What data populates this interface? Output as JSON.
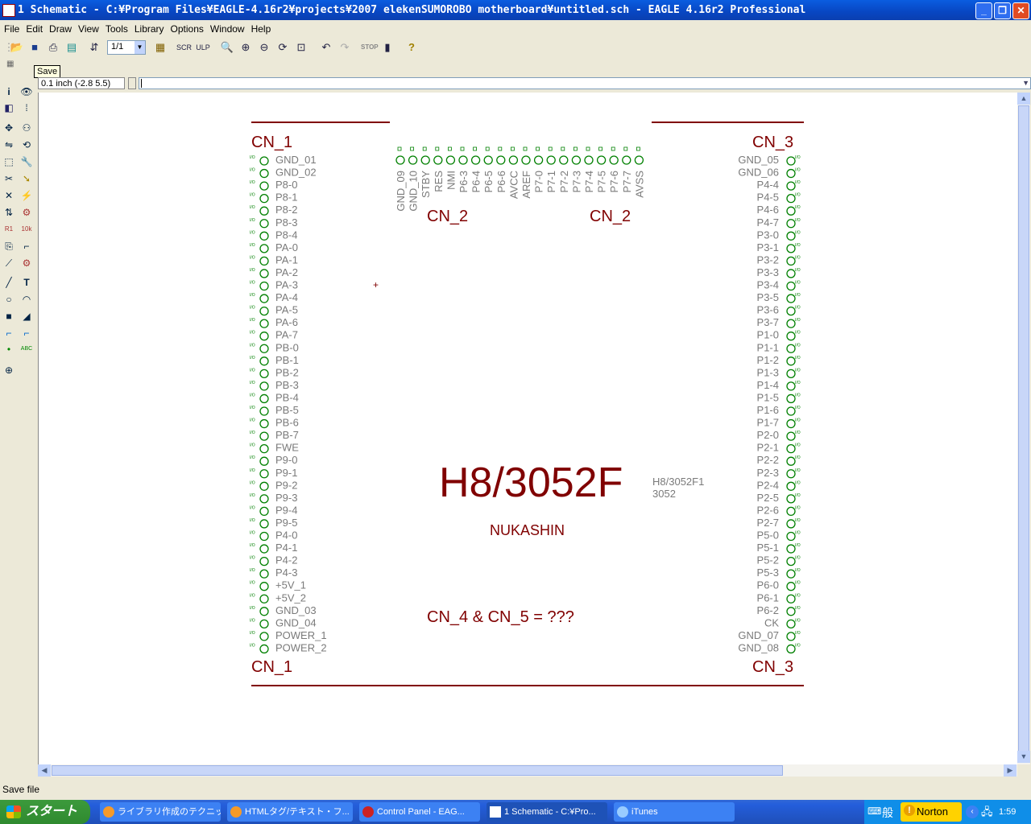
{
  "window": {
    "title": "1 Schematic - C:¥Program Files¥EAGLE-4.16r2¥projects¥2007 elekenSUMOROBO motherboard¥untitled.sch - EAGLE 4.16r2 Professional"
  },
  "menu": [
    "File",
    "Edit",
    "Draw",
    "View",
    "Tools",
    "Library",
    "Options",
    "Window",
    "Help"
  ],
  "toolbar": {
    "sheet_select": "1/1",
    "tooltip": "Save"
  },
  "coords": {
    "grid": "0.1 inch (-2.8 5.5)"
  },
  "command_line": {
    "value": ""
  },
  "status": {
    "text": "Save file"
  },
  "schematic": {
    "connectors": {
      "cn1": "CN_1",
      "cn2": "CN_2",
      "cn3": "CN_3"
    },
    "chip_name": "H8/3052F",
    "chip_value_1": "H8/3052F1",
    "chip_value_2": "3052",
    "author": "NUKASHIN",
    "note": "CN_4 & CN_5 = ???",
    "pin_io_label": "I/O",
    "cn1_pins": [
      "GND_01",
      "GND_02",
      "P8-0",
      "P8-1",
      "P8-2",
      "P8-3",
      "P8-4",
      "PA-0",
      "PA-1",
      "PA-2",
      "PA-3",
      "PA-4",
      "PA-5",
      "PA-6",
      "PA-7",
      "PB-0",
      "PB-1",
      "PB-2",
      "PB-3",
      "PB-4",
      "PB-5",
      "PB-6",
      "PB-7",
      "FWE",
      "P9-0",
      "P9-1",
      "P9-2",
      "P9-3",
      "P9-4",
      "P9-5",
      "P4-0",
      "P4-1",
      "P4-2",
      "P4-3",
      "+5V_1",
      "+5V_2",
      "GND_03",
      "GND_04",
      "POWER_1",
      "POWER_2"
    ],
    "cn3_pins": [
      "GND_05",
      "GND_06",
      "P4-4",
      "P4-5",
      "P4-6",
      "P4-7",
      "P3-0",
      "P3-1",
      "P3-2",
      "P3-3",
      "P3-4",
      "P3-5",
      "P3-6",
      "P3-7",
      "P1-0",
      "P1-1",
      "P1-2",
      "P1-3",
      "P1-4",
      "P1-5",
      "P1-6",
      "P1-7",
      "P2-0",
      "P2-1",
      "P2-2",
      "P2-3",
      "P2-4",
      "P2-5",
      "P2-6",
      "P2-7",
      "P5-0",
      "P5-1",
      "P5-2",
      "P5-3",
      "P6-0",
      "P6-1",
      "P6-2",
      "CK",
      "GND_07",
      "GND_08"
    ],
    "cn2_pins": [
      "GND_09",
      "GND_10",
      "STBY",
      "RES",
      "NMI",
      "P6-3",
      "P6-4",
      "P6-5",
      "P6-6",
      "AVCC",
      "AREF",
      "P7-0",
      "P7-1",
      "P7-2",
      "P7-3",
      "P7-4",
      "P7-5",
      "P7-6",
      "P7-7",
      "AVSS"
    ]
  },
  "taskbar": {
    "start": "スタート",
    "tasks": [
      "ライブラリ作成のテクニッ...",
      "HTMLタグ/テキスト・フ...",
      "Control Panel - EAG...",
      "1 Schematic - C:¥Pro...",
      "iTunes"
    ],
    "ime": "般",
    "norton": "Norton",
    "clock": "1:59"
  },
  "colors": {
    "schematic_red": "#800000",
    "pin_green": "#008000",
    "xp_blue": "#0a5de0"
  }
}
